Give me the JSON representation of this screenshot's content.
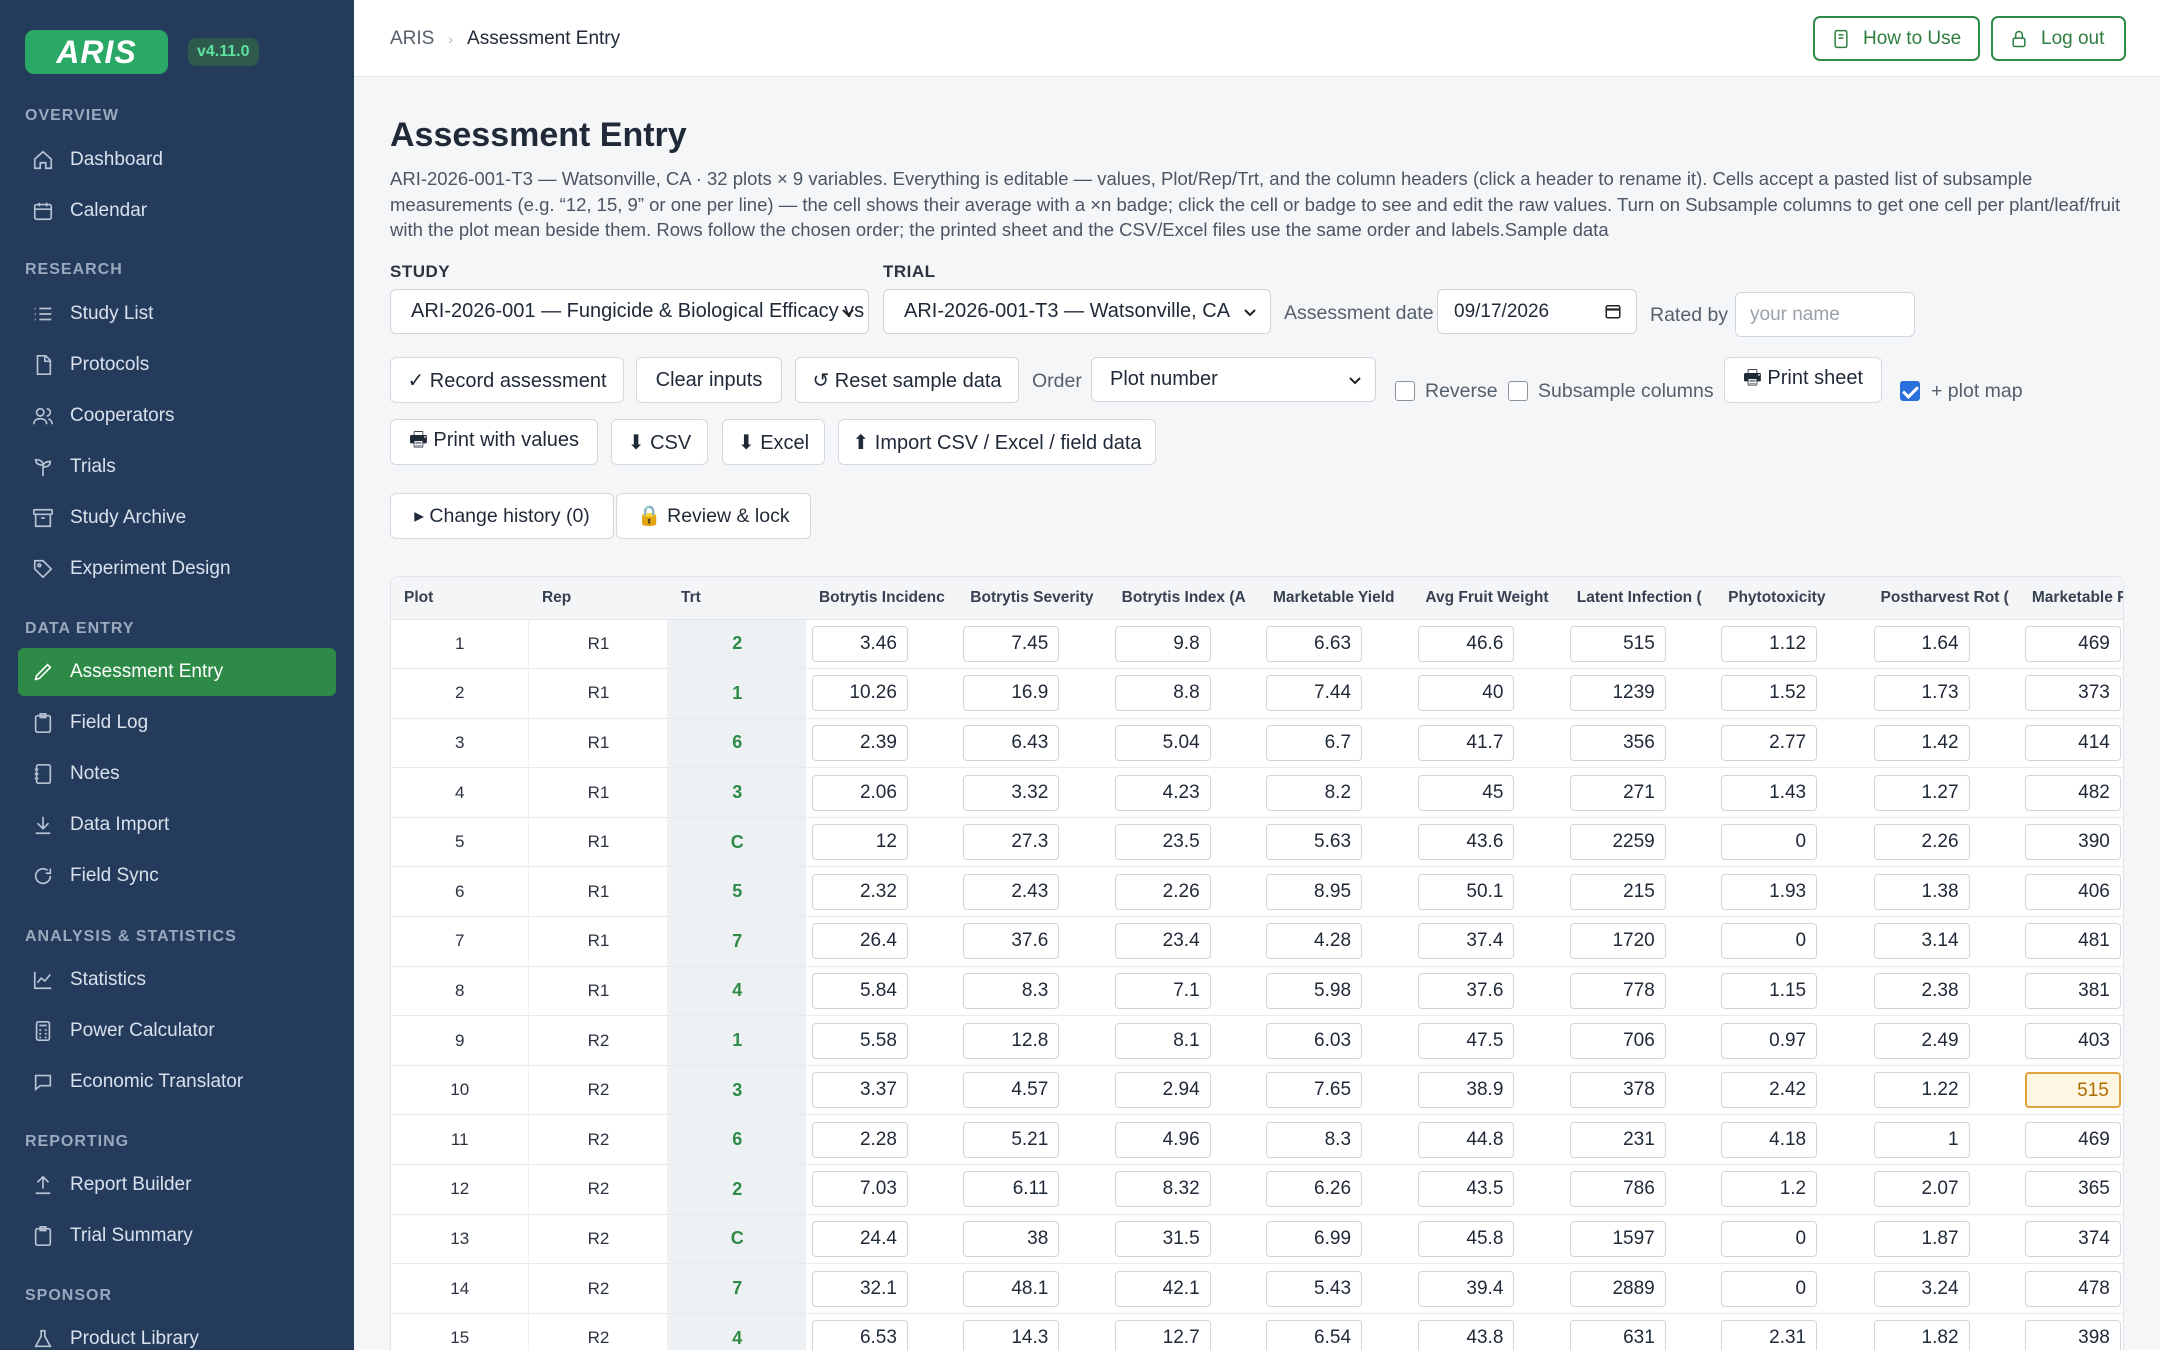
{
  "app": {
    "logo": "ARIS",
    "version": "v4.11.0"
  },
  "sidebar": {
    "sections": [
      "OVERVIEW",
      "RESEARCH",
      "DATA ENTRY",
      "ANALYSIS & STATISTICS",
      "REPORTING",
      "SPONSOR"
    ],
    "items": [
      "Dashboard",
      "Calendar",
      "Study List",
      "Protocols",
      "Cooperators",
      "Trials",
      "Study Archive",
      "Experiment Design",
      "Assessment Entry",
      "Field Log",
      "Notes",
      "Data Import",
      "Field Sync",
      "Statistics",
      "Power Calculator",
      "Economic Translator",
      "Report Builder",
      "Trial Summary",
      "Product Library"
    ],
    "active": "Assessment Entry",
    "accent": "#2e8b47"
  },
  "breadcrumb": {
    "root": "ARIS",
    "current": "Assessment Entry"
  },
  "topbar": {
    "how_to_use": "How to Use",
    "logout": "Log out"
  },
  "page": {
    "title": "Assessment Entry",
    "description": "ARI-2026-001-T3 — Watsonville, CA · 32 plots × 9 variables. Everything is editable — values, Plot/Rep/Trt, and the column headers (click a header to rename it). Cells accept a pasted list of subsample measurements (e.g. “12, 15, 9” or one per line) — the cell shows their average with a ×n badge; click the cell or badge to see and edit the raw values. Turn on Subsample columns to get one cell per plant/leaf/fruit with the plot mean beside them. Rows follow the chosen order; the printed sheet and the CSV/Excel files use the same order and labels.Sample data"
  },
  "form": {
    "study_label": "STUDY",
    "study_value": "ARI-2026-001 — Fungicide & Biological Efficacy vs",
    "trial_label": "TRIAL",
    "trial_value": "ARI-2026-001-T3 — Watsonville, CA",
    "date_label": "Assessment date",
    "date_value": "09/17/2026",
    "rated_label": "Rated by",
    "rated_placeholder": "your name",
    "order_label": "Order",
    "order_value": "Plot number",
    "reverse_label": "Reverse",
    "reverse_checked": false,
    "subsample_label": "Subsample columns",
    "subsample_checked": false,
    "plotmap_label": "+ plot map",
    "plotmap_checked": true
  },
  "buttons": {
    "record": "✓ Record assessment",
    "clear": "Clear inputs",
    "reset": "↺ Reset sample data",
    "print_sheet": "🖶 Print sheet",
    "print_values": "🖶 Print with values",
    "csv": "⬇ CSV",
    "excel": "⬇ Excel",
    "import": "⬆ Import CSV / Excel / field data",
    "history": "▸  Change history (0)",
    "review": "🔒  Review & lock"
  },
  "table": {
    "headers": [
      "Plot",
      "Rep",
      "Trt",
      "Botrytis Incidenc",
      "Botrytis Severity",
      "Botrytis Index (A",
      "Marketable Yield",
      "Avg Fruit Weight",
      "Latent Infection (",
      "Phytotoxicity",
      "Postharvest Rot (",
      "Marketable Fruit"
    ],
    "rows": [
      [
        "1",
        "R1",
        "2",
        "3.46",
        "7.45",
        "9.8",
        "6.63",
        "46.6",
        "515",
        "1.12",
        "1.64",
        "469"
      ],
      [
        "2",
        "R1",
        "1",
        "10.26",
        "16.9",
        "8.8",
        "7.44",
        "40",
        "1239",
        "1.52",
        "1.73",
        "373"
      ],
      [
        "3",
        "R1",
        "6",
        "2.39",
        "6.43",
        "5.04",
        "6.7",
        "41.7",
        "356",
        "2.77",
        "1.42",
        "414"
      ],
      [
        "4",
        "R1",
        "3",
        "2.06",
        "3.32",
        "4.23",
        "8.2",
        "45",
        "271",
        "1.43",
        "1.27",
        "482"
      ],
      [
        "5",
        "R1",
        "C",
        "12",
        "27.3",
        "23.5",
        "5.63",
        "43.6",
        "2259",
        "0",
        "2.26",
        "390"
      ],
      [
        "6",
        "R1",
        "5",
        "2.32",
        "2.43",
        "2.26",
        "8.95",
        "50.1",
        "215",
        "1.93",
        "1.38",
        "406"
      ],
      [
        "7",
        "R1",
        "7",
        "26.4",
        "37.6",
        "23.4",
        "4.28",
        "37.4",
        "1720",
        "0",
        "3.14",
        "481"
      ],
      [
        "8",
        "R1",
        "4",
        "5.84",
        "8.3",
        "7.1",
        "5.98",
        "37.6",
        "778",
        "1.15",
        "2.38",
        "381"
      ],
      [
        "9",
        "R2",
        "1",
        "5.58",
        "12.8",
        "8.1",
        "6.03",
        "47.5",
        "706",
        "0.97",
        "2.49",
        "403"
      ],
      [
        "10",
        "R2",
        "3",
        "3.37",
        "4.57",
        "2.94",
        "7.65",
        "38.9",
        "378",
        "2.42",
        "1.22",
        "515"
      ],
      [
        "11",
        "R2",
        "6",
        "2.28",
        "5.21",
        "4.96",
        "8.3",
        "44.8",
        "231",
        "4.18",
        "1",
        "469"
      ],
      [
        "12",
        "R2",
        "2",
        "7.03",
        "6.11",
        "8.32",
        "6.26",
        "43.5",
        "786",
        "1.2",
        "2.07",
        "365"
      ],
      [
        "13",
        "R2",
        "C",
        "24.4",
        "38",
        "31.5",
        "6.99",
        "45.8",
        "1597",
        "0",
        "1.87",
        "374"
      ],
      [
        "14",
        "R2",
        "7",
        "32.1",
        "48.1",
        "42.1",
        "5.43",
        "39.4",
        "2889",
        "0",
        "3.24",
        "478"
      ],
      [
        "15",
        "R2",
        "4",
        "6.53",
        "14.3",
        "12.7",
        "6.54",
        "43.8",
        "631",
        "2.31",
        "1.82",
        "398"
      ]
    ],
    "highlight_cell": {
      "row": 9,
      "col": 11
    }
  }
}
